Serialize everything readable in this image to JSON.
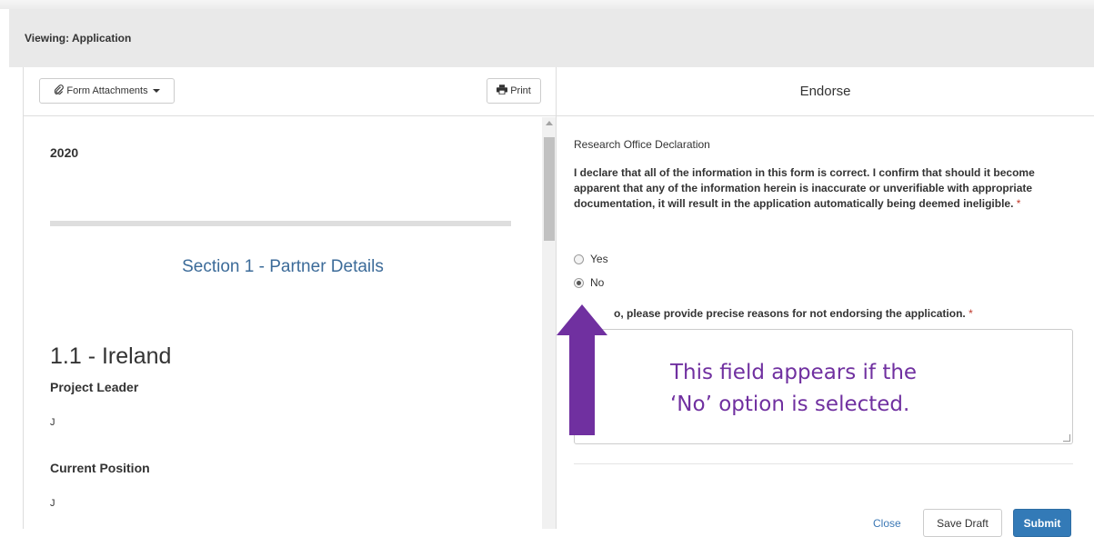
{
  "header": {
    "title": "Viewing: Application"
  },
  "left_toolbar": {
    "attachments_label": "Form Attachments",
    "print_label": "Print"
  },
  "form": {
    "year": "2020",
    "section_title": "Section 1 - Partner Details",
    "subsection_title": "1.1 - Ireland",
    "fields": [
      {
        "label": "Project Leader",
        "value": "J"
      },
      {
        "label": "Current Position",
        "value": "J"
      }
    ]
  },
  "endorse": {
    "title": "Endorse",
    "declaration_title": "Research Office Declaration",
    "declaration_text": "I declare that all of the information in this form is correct. I confirm that should it become apparent that any of the information herein is inaccurate or unverifiable with appropriate documentation, it will result in the application automatically being deemed ineligible.",
    "required_mark": "*",
    "options": [
      {
        "label": "Yes",
        "checked": false
      },
      {
        "label": "No",
        "checked": true
      }
    ],
    "reason_label": "o, please provide precise reasons for not endorsing the application.",
    "reason_value": "",
    "close_label": "Close",
    "save_draft_label": "Save Draft",
    "submit_label": "Submit"
  },
  "annotation": {
    "line1": "This field appears if the",
    "line2": "‘No’ option is selected.",
    "color": "#7030a0"
  },
  "colors": {
    "primary_button": "#337ab7",
    "link": "#3c78b5",
    "section_title": "#3c6b99",
    "required": "#c0392b"
  }
}
